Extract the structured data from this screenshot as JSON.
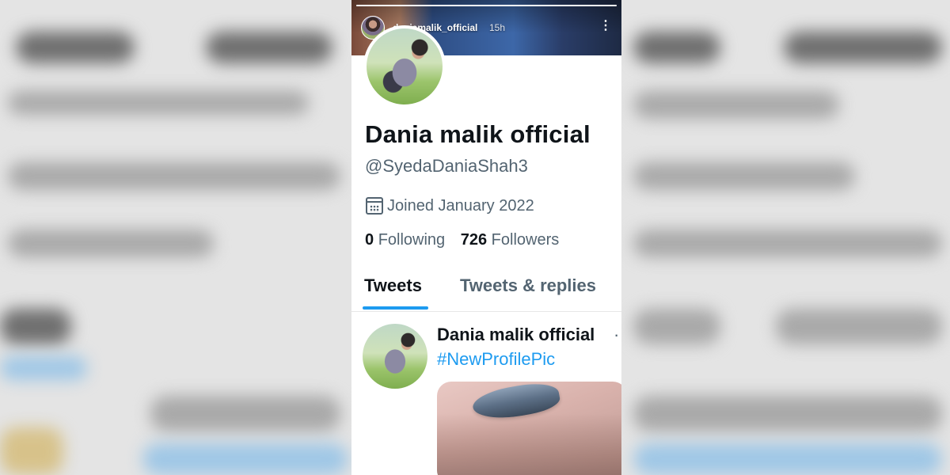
{
  "story": {
    "username": "daniamalik_official",
    "time": "15h",
    "more_icon": "more-vertical-icon",
    "progress": 1.0
  },
  "profile": {
    "display_name": "Dania malik official",
    "handle": "@SyedaDaniaShah3",
    "joined": "Joined January 2022",
    "joined_icon": "calendar-icon",
    "following_count": "0",
    "following_label": "Following",
    "followers_count": "726",
    "followers_label": "Followers"
  },
  "tabs": [
    {
      "label": "Tweets",
      "active": true
    },
    {
      "label": "Tweets & replies",
      "active": false
    }
  ],
  "tweet": {
    "author": "Dania malik official",
    "separator": "·",
    "text": "#NewProfilePic"
  },
  "colors": {
    "accent": "#1d9bf0",
    "text_primary": "#0f1419",
    "text_secondary": "#536471"
  }
}
